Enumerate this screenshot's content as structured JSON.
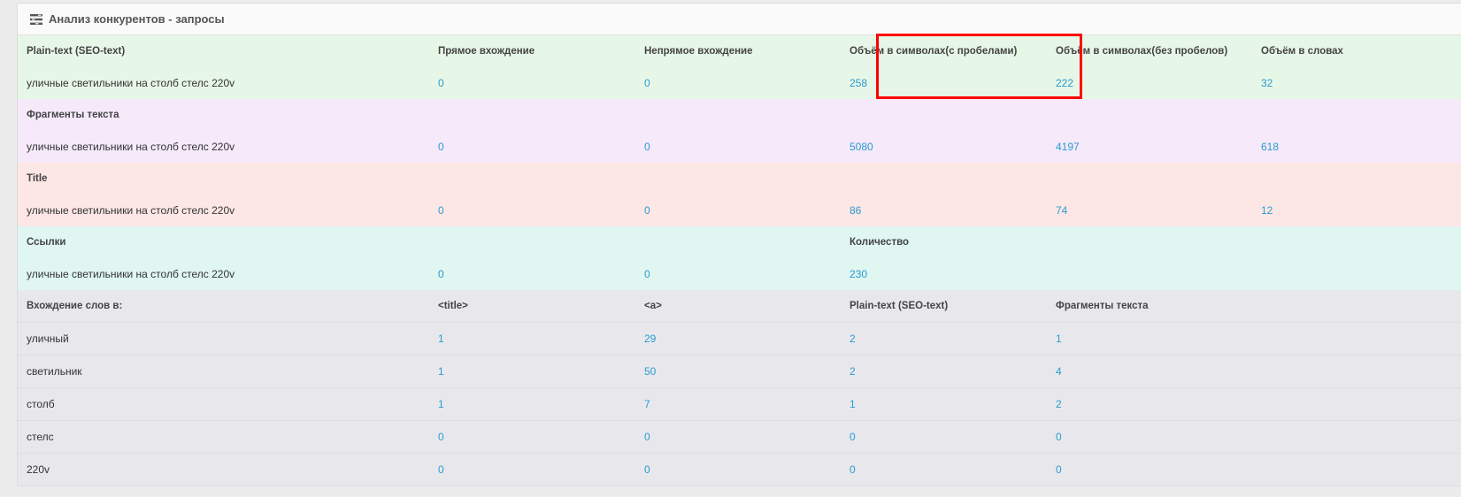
{
  "panel": {
    "title": "Анализ конкурентов - запросы",
    "icon": "tasks-icon"
  },
  "plain_text": {
    "header": [
      "Plain-text (SEO-text)",
      "Прямое вхождение",
      "Непрямое вхождение",
      "Объём в символах(с пробелами)",
      "Объём в символах(без пробелов)",
      "Объём в словах"
    ],
    "row": [
      "уличные светильники на столб стелс 220v",
      "0",
      "0",
      "258",
      "222",
      "32"
    ]
  },
  "fragments": {
    "header": "Фрагменты текста",
    "row": [
      "уличные светильники на столб стелс 220v",
      "0",
      "0",
      "5080",
      "4197",
      "618"
    ]
  },
  "title_section": {
    "header": "Title",
    "row": [
      "уличные светильники на столб стелс 220v",
      "0",
      "0",
      "86",
      "74",
      "12"
    ]
  },
  "links": {
    "header": "Ссылки",
    "count_label": "Количество",
    "row": [
      "уличные светильники на столб стелс 220v",
      "0",
      "0",
      "230"
    ]
  },
  "word_entry": {
    "header": [
      "Вхождение слов в:",
      "<title>",
      "<a>",
      "Plain-text (SEO-text)",
      "Фрагменты текста"
    ],
    "rows": [
      [
        "уличный",
        "1",
        "29",
        "2",
        "1"
      ],
      [
        "светильник",
        "1",
        "50",
        "2",
        "4"
      ],
      [
        "столб",
        "1",
        "7",
        "1",
        "2"
      ],
      [
        "стелс",
        "0",
        "0",
        "0",
        "0"
      ],
      [
        "220v",
        "0",
        "0",
        "0",
        "0"
      ]
    ]
  },
  "colors": {
    "highlight": "#ff0000",
    "value_link": "#2a9bd1"
  }
}
